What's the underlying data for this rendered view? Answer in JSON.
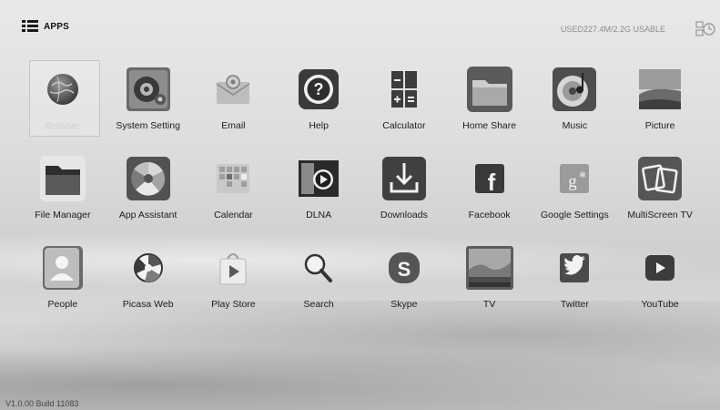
{
  "header": {
    "apps_label": "APPS",
    "storage_text": "USED227.4M/2.2G USABLE"
  },
  "apps": [
    {
      "label": "Browser",
      "icon": "browser-globe-icon"
    },
    {
      "label": "System Setting",
      "icon": "system-setting-gear-icon"
    },
    {
      "label": "Email",
      "icon": "email-envelope-icon"
    },
    {
      "label": "Help",
      "icon": "help-question-icon"
    },
    {
      "label": "Calculator",
      "icon": "calculator-icon"
    },
    {
      "label": "Home Share",
      "icon": "home-share-folder-icon"
    },
    {
      "label": "Music",
      "icon": "music-disc-icon"
    },
    {
      "label": "Picture",
      "icon": "picture-landscape-icon"
    },
    {
      "label": "File Manager",
      "icon": "file-manager-folder-icon"
    },
    {
      "label": "App Assistant",
      "icon": "app-assistant-icon"
    },
    {
      "label": "Calendar",
      "icon": "calendar-icon"
    },
    {
      "label": "DLNA",
      "icon": "dlna-play-icon"
    },
    {
      "label": "Downloads",
      "icon": "download-icon"
    },
    {
      "label": "Facebook",
      "icon": "facebook-icon"
    },
    {
      "label": "Google Settings",
      "icon": "google-settings-icon"
    },
    {
      "label": "MultiScreen TV",
      "icon": "multiscreen-tv-icon"
    },
    {
      "label": "People",
      "icon": "people-contact-icon"
    },
    {
      "label": "Picasa Web",
      "icon": "picasa-icon"
    },
    {
      "label": "Play Store",
      "icon": "play-store-bag-icon"
    },
    {
      "label": "Search",
      "icon": "search-magnifier-icon"
    },
    {
      "label": "Skype",
      "icon": "skype-icon"
    },
    {
      "label": "TV",
      "icon": "tv-landscape-icon"
    },
    {
      "label": "Twitter",
      "icon": "twitter-bird-icon"
    },
    {
      "label": "YouTube",
      "icon": "youtube-play-icon"
    }
  ],
  "footer": {
    "version": "V1.0.00 Build 11083"
  }
}
